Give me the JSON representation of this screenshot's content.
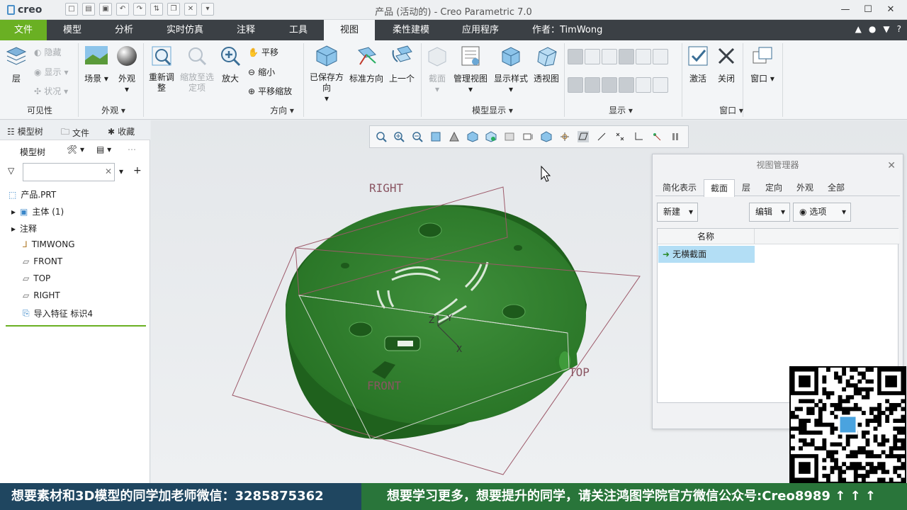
{
  "app": {
    "logo": "creo",
    "window_title": "产品 (活动的) - Creo Parametric 7.0"
  },
  "tabs": [
    "文件",
    "模型",
    "分析",
    "实时仿真",
    "注释",
    "工具",
    "视图",
    "柔性建模",
    "应用程序"
  ],
  "active_tab": "视图",
  "author": "作者：TimWong",
  "ribbon": {
    "visibility": {
      "layer": "层",
      "hide": "隐藏",
      "show": "显示",
      "status": "状况",
      "label": "可见性"
    },
    "appearance": {
      "scene": "场景",
      "appearance": "外观",
      "label": "外观"
    },
    "orientation": {
      "refit": "重新调整",
      "zoom_to_selected": "缩放至选定项",
      "zoom_in": "放大",
      "pan": "平移",
      "zoom_out": "缩小",
      "pan_zoom": "平移缩放",
      "saved_orientations": "已保存方向",
      "standard_orientation": "标准方向",
      "previous": "上一个",
      "label": "方向"
    },
    "model_display": {
      "section": "截面",
      "manage_views": "管理视图",
      "display_style": "显示样式",
      "perspective": "透视图",
      "label": "模型显示"
    },
    "show_group": {
      "label": "显示"
    },
    "window_group": {
      "activate": "激活",
      "close": "关闭",
      "windows": "窗口",
      "label": "窗口"
    }
  },
  "left_panel": {
    "tabs": [
      "模型树",
      "文件",
      "收藏"
    ],
    "tree_label": "模型树",
    "filter_placeholder": "",
    "tree": [
      {
        "label": "产品.PRT",
        "icon": "part-icon"
      },
      {
        "label": "主体 (1)",
        "icon": "body-icon"
      },
      {
        "label": "注释",
        "icon": "annotation-icon"
      },
      {
        "label": "TIMWONG",
        "icon": "csys-icon"
      },
      {
        "label": "FRONT",
        "icon": "datum-plane-icon"
      },
      {
        "label": "TOP",
        "icon": "datum-plane-icon"
      },
      {
        "label": "RIGHT",
        "icon": "datum-plane-icon"
      },
      {
        "label": "导入特征 标识4",
        "icon": "import-feature-icon"
      }
    ]
  },
  "viewport": {
    "plane_labels": {
      "right": "RIGHT",
      "front": "FRONT",
      "top": "TOP"
    },
    "csys": {
      "x": "X",
      "y": "Y",
      "z": "Z"
    }
  },
  "view_manager": {
    "title": "视图管理器",
    "tabs": [
      "简化表示",
      "截面",
      "层",
      "定向",
      "外观",
      "全部"
    ],
    "active_tab": "截面",
    "new_btn": "新建",
    "edit_btn": "编辑",
    "options_btn": "选项",
    "column_name": "名称",
    "rows": [
      "无横截面"
    ]
  },
  "banner": {
    "left": "想要素材和3D模型的同学加老师微信：3285875362",
    "right": "想要学习更多，想要提升的同学，请关注鸿图学院官方微信公众号:Creo8989 ↑ ↑ ↑"
  },
  "colors": {
    "file_tab": "#6ab023",
    "tab_bar": "#3b4045",
    "model_green": "#2e7d2c",
    "banner_left": "#1f4660",
    "banner_right": "#29753a",
    "selection": "#b3def5"
  }
}
